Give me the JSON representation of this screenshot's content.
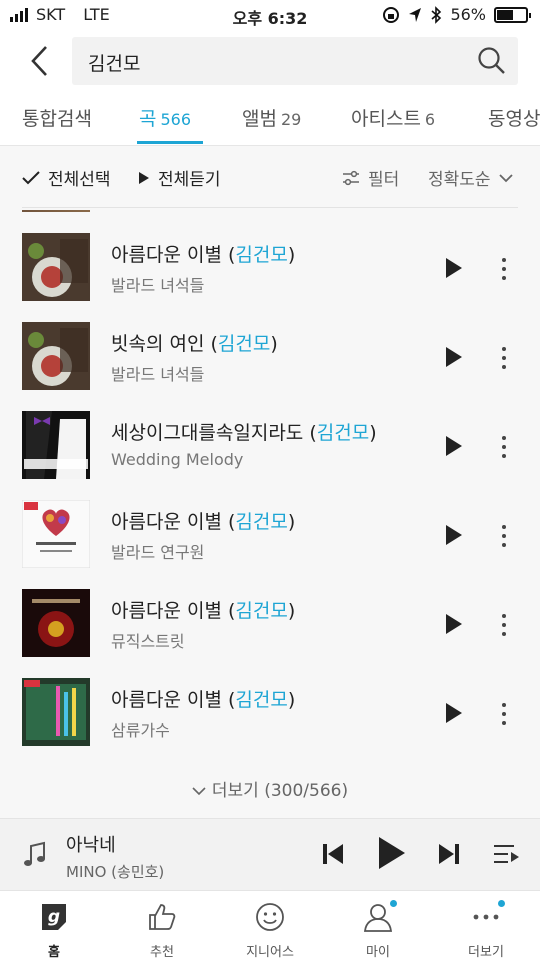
{
  "status_bar": {
    "carrier": "SKT",
    "network": "LTE",
    "time": "오후 6:32",
    "battery_percent": "56%",
    "battery_level": 0.56
  },
  "search": {
    "query": "김건모",
    "back_icon": "chevron-left-icon",
    "search_icon": "search-icon"
  },
  "tabs": [
    {
      "label": "통합검색",
      "count": ""
    },
    {
      "label": "곡",
      "count": "566"
    },
    {
      "label": "앨범",
      "count": "29"
    },
    {
      "label": "아티스트",
      "count": "6"
    },
    {
      "label": "동영상",
      "count": ""
    }
  ],
  "toolbar": {
    "select_all": "전체선택",
    "play_all": "전체듣기",
    "filter": "필터",
    "sort": "정확도순"
  },
  "songs": [
    {
      "title": "아름다운 이별 (",
      "artist": "김건모",
      "close": ")",
      "album": "발라드 녀석들"
    },
    {
      "title": "빗속의 여인 (",
      "artist": "김건모",
      "close": ")",
      "album": "발라드 녀석들"
    },
    {
      "title": "세상이그대를속일지라도 (",
      "artist": "김건모",
      "close": ")",
      "album": "Wedding Melody"
    },
    {
      "title": "아름다운 이별 (",
      "artist": "김건모",
      "close": ")",
      "album": "발라드 연구원"
    },
    {
      "title": "아름다운 이별 (",
      "artist": "김건모",
      "close": ")",
      "album": "뮤직스트릿"
    },
    {
      "title": "아름다운 이별 (",
      "artist": "김건모",
      "close": ")",
      "album": "삼류가수"
    }
  ],
  "load_more": "더보기 (300/566)",
  "player": {
    "title": "아낙네",
    "artist": "MINO (송민호)"
  },
  "nav": [
    {
      "label": "홈",
      "icon": "home-g-icon"
    },
    {
      "label": "추천",
      "icon": "thumbs-up-icon"
    },
    {
      "label": "지니어스",
      "icon": "smile-icon"
    },
    {
      "label": "마이",
      "icon": "person-icon"
    },
    {
      "label": "더보기",
      "icon": "more-dots-icon"
    }
  ],
  "colors": {
    "accent": "#1ea5d4",
    "text": "#222222",
    "subtext": "#777777"
  }
}
